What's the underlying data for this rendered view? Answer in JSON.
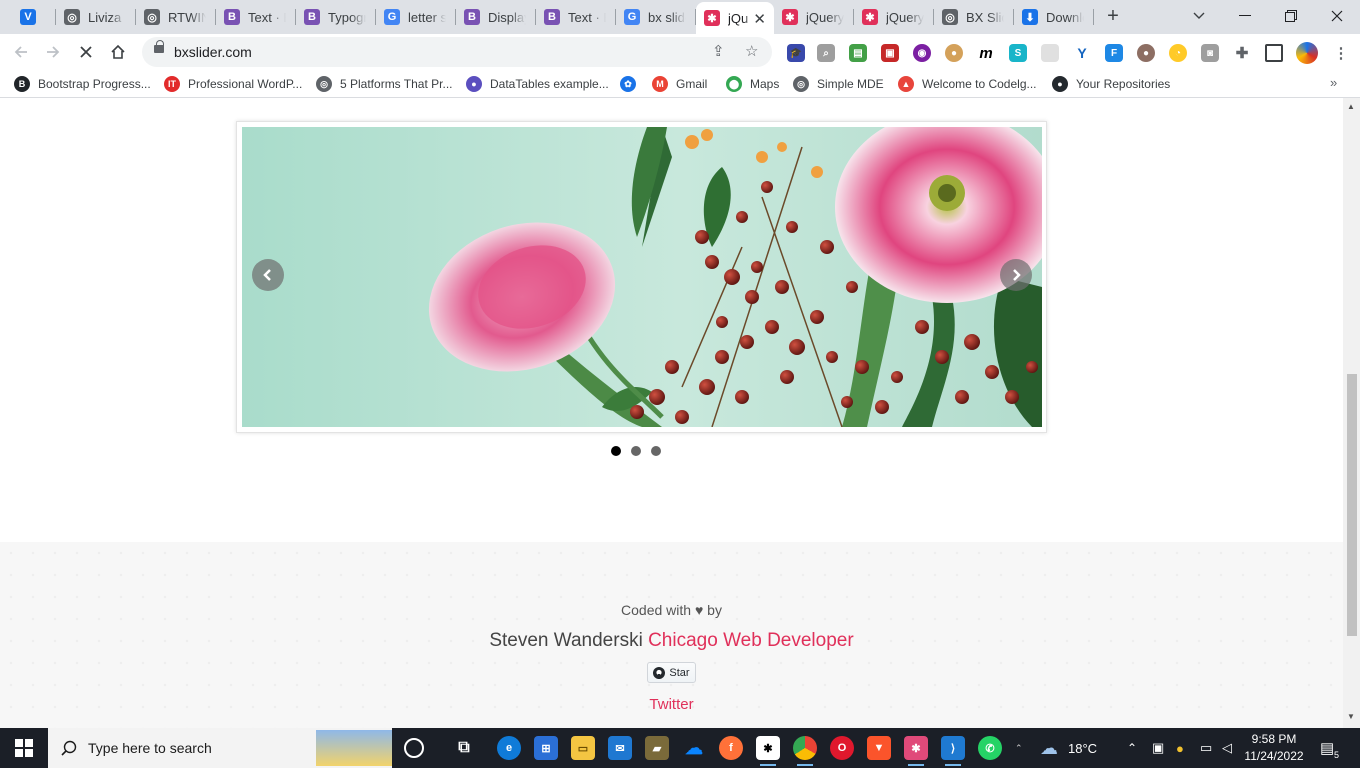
{
  "browser": {
    "tabs": [
      {
        "title": "",
        "icon": "vivaldi-v-icon",
        "color": "#1a73e8",
        "glyph": "V"
      },
      {
        "title": "Liviza D",
        "icon": "globe-icon",
        "color": "#5f6368",
        "glyph": "◎"
      },
      {
        "title": "RTWIN",
        "icon": "globe-icon",
        "color": "#5f6368",
        "glyph": "◎"
      },
      {
        "title": "Text · Bo",
        "icon": "bootstrap-icon",
        "color": "#7952b3",
        "glyph": "B"
      },
      {
        "title": "Typogra",
        "icon": "bootstrap-icon",
        "color": "#7952b3",
        "glyph": "B"
      },
      {
        "title": "letter sp",
        "icon": "google-icon",
        "color": "#4285f4",
        "glyph": "G"
      },
      {
        "title": "Display",
        "icon": "bootstrap-icon",
        "color": "#7952b3",
        "glyph": "B"
      },
      {
        "title": "Text · Bo",
        "icon": "bootstrap-icon",
        "color": "#7952b3",
        "glyph": "B"
      },
      {
        "title": "bx slide",
        "icon": "google-icon",
        "color": "#4285f4",
        "glyph": "G"
      },
      {
        "title": "jQu",
        "icon": "jquery-icon",
        "color": "#e0305a",
        "glyph": "✱",
        "active": true
      },
      {
        "title": "jQuery",
        "icon": "star-favicon-icon",
        "color": "#e0305a",
        "glyph": "✱"
      },
      {
        "title": "jQuery",
        "icon": "star-favicon-icon",
        "color": "#e0305a",
        "glyph": "✱"
      },
      {
        "title": "BX Slide",
        "icon": "globe-icon",
        "color": "#5f6368",
        "glyph": "◎"
      },
      {
        "title": "Downlo",
        "icon": "download-icon",
        "color": "#1a73e8",
        "glyph": "⬇"
      }
    ],
    "url": "bxslider.com",
    "bookmarks": [
      {
        "label": "Bootstrap Progress...",
        "icon": "bootstrap-icon",
        "color": "#212529",
        "glyph": "B"
      },
      {
        "label": "Professional WordP...",
        "icon": "it-icon",
        "color": "#e22b2b",
        "glyph": "IT"
      },
      {
        "label": "5 Platforms That Pr...",
        "icon": "globe-icon",
        "color": "#5f6368",
        "glyph": "◎"
      },
      {
        "label": "DataTables example...",
        "icon": "datatables-icon",
        "color": "#5b4fbf",
        "glyph": "●"
      },
      {
        "label": "",
        "icon": "gear-blue-icon",
        "color": "#1a73e8",
        "glyph": "✿"
      },
      {
        "label": "Gmail",
        "icon": "gmail-icon",
        "color": "#ea4335",
        "glyph": "M"
      },
      {
        "label": "Maps",
        "icon": "maps-pin-icon",
        "color": "#34a853",
        "glyph": "⬤"
      },
      {
        "label": "Simple MDE",
        "icon": "globe-icon",
        "color": "#5f6368",
        "glyph": "◎"
      },
      {
        "label": "Welcome to Codelg...",
        "icon": "flame-icon",
        "color": "#e8453c",
        "glyph": "▲"
      },
      {
        "label": "Your Repositories",
        "icon": "github-icon",
        "color": "#24292e",
        "glyph": "●"
      }
    ]
  },
  "page": {
    "pager_count": 3,
    "pager_active": 0,
    "footer": {
      "coded_with": "Coded with ♥ by",
      "author": "Steven Wanderski",
      "author_link": "Chicago Web Developer",
      "star_label": "Star",
      "twitter": "Twitter"
    }
  },
  "taskbar": {
    "search_placeholder": "Type here to search",
    "temperature": "18°C",
    "time": "9:58 PM",
    "date": "11/24/2022",
    "notification_count": "5"
  }
}
